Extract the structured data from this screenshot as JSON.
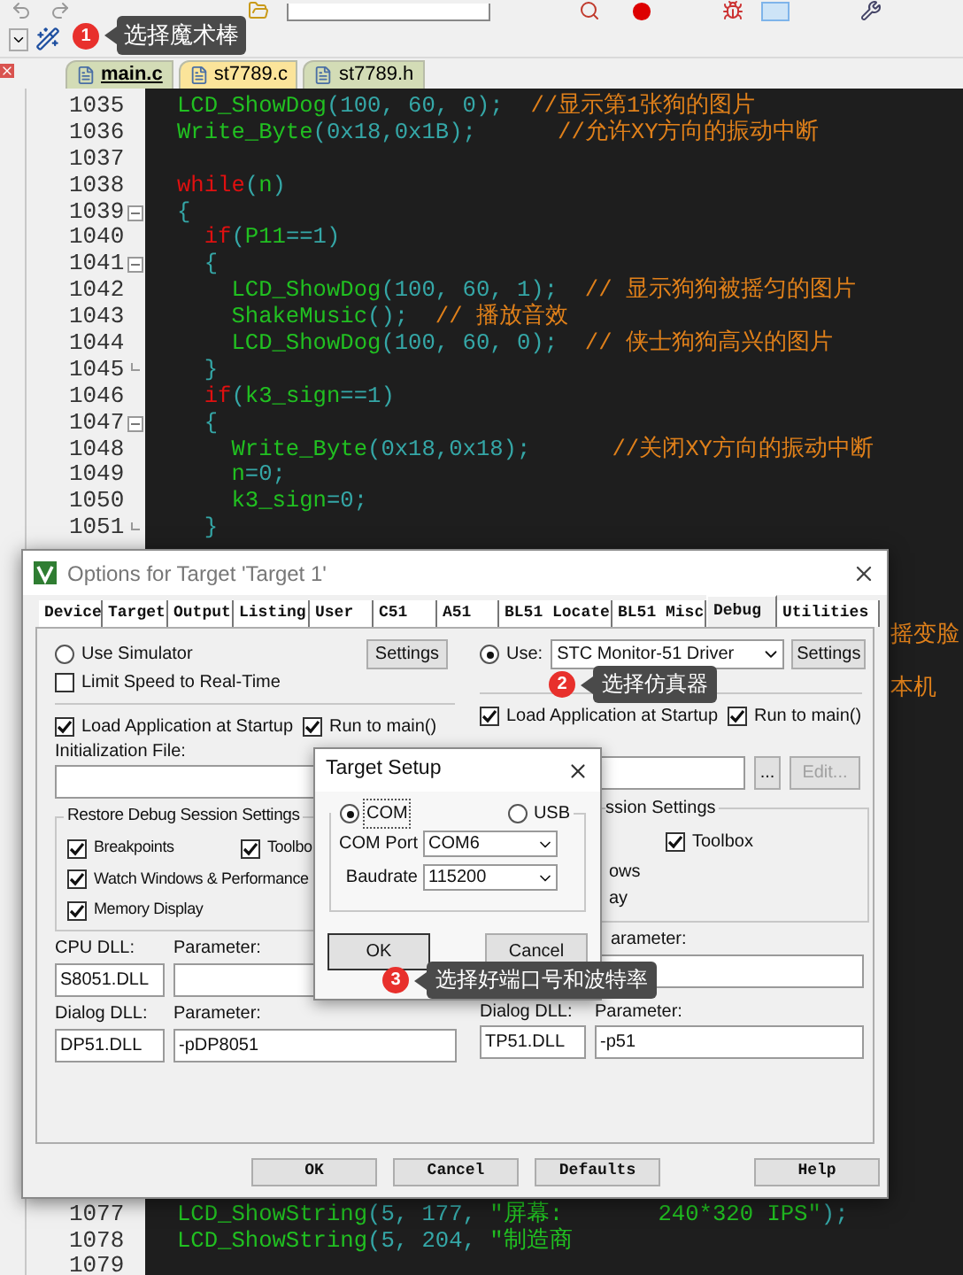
{
  "callouts": [
    {
      "number": "1",
      "text": "选择魔术棒"
    },
    {
      "number": "2",
      "text": "选择仿真器"
    },
    {
      "number": "3",
      "text": "选择好端口号和波特率"
    }
  ],
  "file_tabs": [
    {
      "label": "main.c",
      "selected": true,
      "color": "#d3dcb6"
    },
    {
      "label": "st7789.c",
      "selected": false,
      "color": "#fbe49a"
    },
    {
      "label": "st7789.h",
      "selected": false,
      "color": "#d3dcb6"
    }
  ],
  "editor": {
    "lines": [
      {
        "number": "1035",
        "collapsible": false,
        "block_end": false,
        "tokens": [
          {
            "text": "LCD_ShowDog",
            "kind": "ident"
          },
          {
            "text": "(100, 60, 0);  ",
            "kind": "punct"
          },
          {
            "text": "//显示第1张狗的图片",
            "kind": "comment"
          }
        ]
      },
      {
        "number": "1036",
        "collapsible": false,
        "block_end": false,
        "tokens": [
          {
            "text": "Write_Byte",
            "kind": "ident"
          },
          {
            "text": "(0x18,0x1B);      ",
            "kind": "punct"
          },
          {
            "text": "//允许XY方向的振动中断",
            "kind": "comment"
          }
        ]
      },
      {
        "number": "1037",
        "collapsible": false,
        "block_end": false
      },
      {
        "number": "1038",
        "collapsible": false,
        "block_end": false,
        "tokens": [
          {
            "text": "while",
            "kind": "keyword"
          },
          {
            "text": "(",
            "kind": "punct"
          },
          {
            "text": "n",
            "kind": "ident"
          },
          {
            "text": ")",
            "kind": "punct"
          }
        ]
      },
      {
        "number": "1039",
        "collapsible": true,
        "block_end": false,
        "tokens": [
          {
            "text": "{",
            "kind": "punct"
          }
        ]
      },
      {
        "number": "1040",
        "collapsible": false,
        "block_end": false,
        "tokens": [
          {
            "text": "  if",
            "kind": "keyword"
          },
          {
            "text": "(",
            "kind": "punct"
          },
          {
            "text": "P11",
            "kind": "ident"
          },
          {
            "text": "==1)",
            "kind": "punct"
          }
        ]
      },
      {
        "number": "1041",
        "collapsible": true,
        "block_end": false,
        "tokens": [
          {
            "text": "  {",
            "kind": "punct"
          }
        ]
      },
      {
        "number": "1042",
        "collapsible": false,
        "block_end": false,
        "tokens": [
          {
            "text": "    LCD_ShowDog",
            "kind": "ident"
          },
          {
            "text": "(100, 60, 1);  ",
            "kind": "punct"
          },
          {
            "text": "// 显示狗狗被摇匀的图片",
            "kind": "comment"
          }
        ]
      },
      {
        "number": "1043",
        "collapsible": false,
        "block_end": false,
        "tokens": [
          {
            "text": "    ShakeMusic",
            "kind": "ident"
          },
          {
            "text": "();  ",
            "kind": "punct"
          },
          {
            "text": "// 播放音效",
            "kind": "comment"
          }
        ]
      },
      {
        "number": "1044",
        "collapsible": false,
        "block_end": false,
        "tokens": [
          {
            "text": "    LCD_ShowDog",
            "kind": "ident"
          },
          {
            "text": "(100, 60, 0);  ",
            "kind": "punct"
          },
          {
            "text": "// 侠士狗狗高兴的图片",
            "kind": "comment"
          }
        ]
      },
      {
        "number": "1045",
        "collapsible": false,
        "block_end": true,
        "tokens": [
          {
            "text": "  }",
            "kind": "punct"
          }
        ]
      },
      {
        "number": "1046",
        "collapsible": false,
        "block_end": false,
        "tokens": [
          {
            "text": "  if",
            "kind": "keyword"
          },
          {
            "text": "(",
            "kind": "punct"
          },
          {
            "text": "k3_sign",
            "kind": "ident"
          },
          {
            "text": "==1)",
            "kind": "punct"
          }
        ]
      },
      {
        "number": "1047",
        "collapsible": true,
        "block_end": false,
        "tokens": [
          {
            "text": "  {",
            "kind": "punct"
          }
        ]
      },
      {
        "number": "1048",
        "collapsible": false,
        "block_end": false,
        "tokens": [
          {
            "text": "    Write_Byte",
            "kind": "ident"
          },
          {
            "text": "(0x18,0x18);      ",
            "kind": "punct"
          },
          {
            "text": "//关闭XY方向的振动中断",
            "kind": "comment"
          }
        ]
      },
      {
        "number": "1049",
        "collapsible": false,
        "block_end": false,
        "tokens": [
          {
            "text": "    n",
            "kind": "ident"
          },
          {
            "text": "=0;",
            "kind": "punct"
          }
        ]
      },
      {
        "number": "1050",
        "collapsible": false,
        "block_end": false,
        "tokens": [
          {
            "text": "    k3_sign",
            "kind": "ident"
          },
          {
            "text": "=0;",
            "kind": "punct"
          }
        ]
      },
      {
        "number": "1051",
        "collapsible": false,
        "block_end": true,
        "tokens": [
          {
            "text": "  }",
            "kind": "punct"
          }
        ]
      }
    ],
    "fragments": [
      "摇变脸",
      "本机"
    ],
    "bottom_lines": [
      {
        "number": "1077",
        "tokens": [
          {
            "text": "LCD_ShowString",
            "kind": "ident"
          },
          {
            "text": "(5, 177, ",
            "kind": "punct"
          },
          {
            "text": "\"屏幕:       240*320 IPS\"",
            "kind": "ident"
          },
          {
            "text": ");",
            "kind": "punct"
          }
        ]
      },
      {
        "number": "1078",
        "tokens": [
          {
            "text": "LCD_ShowString",
            "kind": "ident"
          },
          {
            "text": "(5, 204, ",
            "kind": "punct"
          },
          {
            "text": "\"制造商",
            "kind": "ident"
          }
        ]
      },
      {
        "number": "1079"
      }
    ]
  },
  "options_dialog": {
    "title": "Options for Target 'Target 1'",
    "tabs": [
      {
        "label": "Device",
        "selected": false
      },
      {
        "label": "Target",
        "selected": false
      },
      {
        "label": "Output",
        "selected": false
      },
      {
        "label": "Listing",
        "selected": false
      },
      {
        "label": "User",
        "selected": false
      },
      {
        "label": "C51",
        "selected": false
      },
      {
        "label": "A51",
        "selected": false
      },
      {
        "label": "BL51 Locate",
        "selected": false
      },
      {
        "label": "BL51 Misc",
        "selected": false
      },
      {
        "label": "Debug",
        "selected": true
      },
      {
        "label": "Utilities",
        "selected": false
      }
    ],
    "left": {
      "use_simulator": {
        "label": "Use Simulator",
        "selected": false
      },
      "settings": "Settings",
      "limit_speed": {
        "label": "Limit Speed to Real-Time",
        "checked": false
      },
      "load_app": {
        "label": "Load Application at Startup",
        "checked": true
      },
      "run_to_main": {
        "label": "Run to main()",
        "checked": true
      },
      "init_file_label": "Initialization File:",
      "restore": {
        "legend": "Restore Debug Session Settings",
        "options": [
          {
            "label": "Breakpoints",
            "checked": true
          },
          {
            "label": "Toolbo",
            "checked": true
          },
          {
            "label": "Watch Windows & Performance",
            "checked": true
          },
          {
            "label": "Memory Display",
            "checked": true
          }
        ]
      },
      "cpu_dll": {
        "label": "CPU DLL:",
        "value": "S8051.DLL"
      },
      "cpu_param": {
        "label": "Parameter:"
      },
      "dialog_dll": {
        "label": "Dialog DLL:",
        "value": "DP51.DLL"
      },
      "dialog_param": {
        "label": "Parameter:",
        "value": "-pDP8051"
      }
    },
    "right": {
      "use": {
        "label": "Use:",
        "selected": true,
        "driver": "STC Monitor-51 Driver"
      },
      "settings": "Settings",
      "load_app": {
        "label": "Load Application at Startup",
        "checked": true
      },
      "run_to_main": {
        "label": "Run to main()",
        "checked": true
      },
      "browse": "...",
      "edit": {
        "label": "Edit...",
        "disabled": true
      },
      "restore": {
        "legend": "ssion Settings",
        "options": [
          {
            "kind": "checkbox",
            "label": "Toolbox",
            "checked": true
          },
          {
            "kind": "cut_text",
            "label": "ows"
          },
          {
            "kind": "cut_text",
            "label": "ay"
          }
        ]
      },
      "cpu_param": {
        "label": "arameter:"
      },
      "dialog_dll": {
        "label": "Dialog DLL:",
        "value": "TP51.DLL"
      },
      "dialog_param": {
        "label": "Parameter:",
        "value": "-p51"
      }
    },
    "buttons": [
      "OK",
      "Cancel",
      "Defaults",
      "Help"
    ]
  },
  "target_setup": {
    "title": "Target Setup",
    "interfaces": [
      {
        "label": "COM",
        "selected": true
      },
      {
        "label": "USB",
        "selected": false
      }
    ],
    "com_port": {
      "label": "COM Port",
      "value": "COM6"
    },
    "baudrate": {
      "label": "Baudrate",
      "value": "115200"
    },
    "buttons": [
      "OK",
      "Cancel"
    ]
  }
}
